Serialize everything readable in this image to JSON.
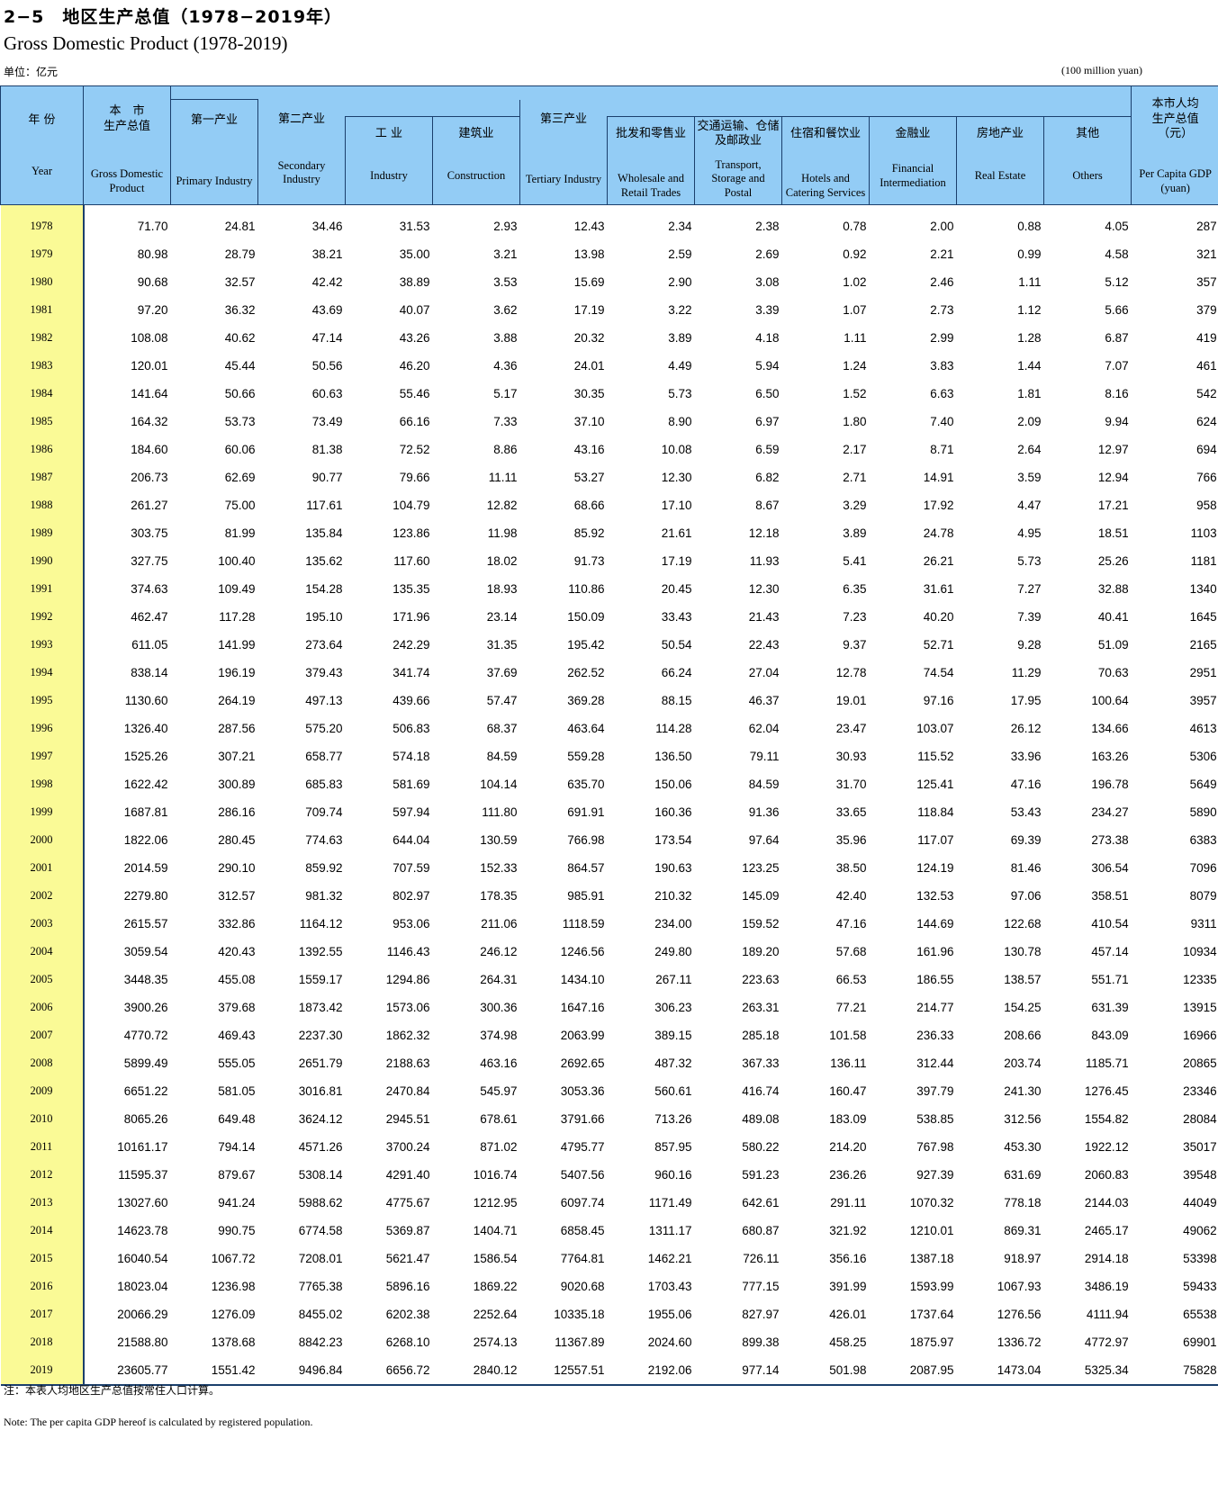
{
  "title_cn": "2−5　地区生产总值（1978−2019年）",
  "title_en": "Gross Domestic Product (1978-2019)",
  "unit_cn": "单位：亿元",
  "unit_en": "(100 million yuan)",
  "headers": {
    "year": {
      "cn": "年 份",
      "en": "Year"
    },
    "gdp": {
      "cn": "本　市\n生产总值",
      "en": "Gross Domestic Product"
    },
    "primary": {
      "cn": "第一产业",
      "en": "Primary Industry"
    },
    "secondary": {
      "cn": "第二产业",
      "en": "Secondary Industry"
    },
    "industry": {
      "cn": "工 业",
      "en": "Industry"
    },
    "construction": {
      "cn": "建筑业",
      "en": "Construction"
    },
    "tertiary": {
      "cn": "第三产业",
      "en": "Tertiary Industry"
    },
    "wholesale": {
      "cn": "批发和零售业",
      "en": "Wholesale and Retail Trades"
    },
    "transport": {
      "cn": "交通运输、仓储及邮政业",
      "en": "Transport, Storage and Postal"
    },
    "hotels": {
      "cn": "住宿和餐饮业",
      "en": "Hotels and Catering Services"
    },
    "finance": {
      "cn": "金融业",
      "en": "Financial Intermediation"
    },
    "realestate": {
      "cn": "房地产业",
      "en": "Real Estate"
    },
    "others": {
      "cn": "其他",
      "en": "Others"
    },
    "percapita": {
      "cn": "本市人均\n生产总值\n（元）",
      "en": "Per Capita GDP (yuan)"
    }
  },
  "rows": [
    [
      "1978",
      "71.70",
      "24.81",
      "34.46",
      "31.53",
      "2.93",
      "12.43",
      "2.34",
      "2.38",
      "0.78",
      "2.00",
      "0.88",
      "4.05",
      "287"
    ],
    [
      "1979",
      "80.98",
      "28.79",
      "38.21",
      "35.00",
      "3.21",
      "13.98",
      "2.59",
      "2.69",
      "0.92",
      "2.21",
      "0.99",
      "4.58",
      "321"
    ],
    [
      "1980",
      "90.68",
      "32.57",
      "42.42",
      "38.89",
      "3.53",
      "15.69",
      "2.90",
      "3.08",
      "1.02",
      "2.46",
      "1.11",
      "5.12",
      "357"
    ],
    [
      "1981",
      "97.20",
      "36.32",
      "43.69",
      "40.07",
      "3.62",
      "17.19",
      "3.22",
      "3.39",
      "1.07",
      "2.73",
      "1.12",
      "5.66",
      "379"
    ],
    [
      "1982",
      "108.08",
      "40.62",
      "47.14",
      "43.26",
      "3.88",
      "20.32",
      "3.89",
      "4.18",
      "1.11",
      "2.99",
      "1.28",
      "6.87",
      "419"
    ],
    [
      "1983",
      "120.01",
      "45.44",
      "50.56",
      "46.20",
      "4.36",
      "24.01",
      "4.49",
      "5.94",
      "1.24",
      "3.83",
      "1.44",
      "7.07",
      "461"
    ],
    [
      "1984",
      "141.64",
      "50.66",
      "60.63",
      "55.46",
      "5.17",
      "30.35",
      "5.73",
      "6.50",
      "1.52",
      "6.63",
      "1.81",
      "8.16",
      "542"
    ],
    [
      "1985",
      "164.32",
      "53.73",
      "73.49",
      "66.16",
      "7.33",
      "37.10",
      "8.90",
      "6.97",
      "1.80",
      "7.40",
      "2.09",
      "9.94",
      "624"
    ],
    [
      "1986",
      "184.60",
      "60.06",
      "81.38",
      "72.52",
      "8.86",
      "43.16",
      "10.08",
      "6.59",
      "2.17",
      "8.71",
      "2.64",
      "12.97",
      "694"
    ],
    [
      "1987",
      "206.73",
      "62.69",
      "90.77",
      "79.66",
      "11.11",
      "53.27",
      "12.30",
      "6.82",
      "2.71",
      "14.91",
      "3.59",
      "12.94",
      "766"
    ],
    [
      "1988",
      "261.27",
      "75.00",
      "117.61",
      "104.79",
      "12.82",
      "68.66",
      "17.10",
      "8.67",
      "3.29",
      "17.92",
      "4.47",
      "17.21",
      "958"
    ],
    [
      "1989",
      "303.75",
      "81.99",
      "135.84",
      "123.86",
      "11.98",
      "85.92",
      "21.61",
      "12.18",
      "3.89",
      "24.78",
      "4.95",
      "18.51",
      "1103"
    ],
    [
      "1990",
      "327.75",
      "100.40",
      "135.62",
      "117.60",
      "18.02",
      "91.73",
      "17.19",
      "11.93",
      "5.41",
      "26.21",
      "5.73",
      "25.26",
      "1181"
    ],
    [
      "1991",
      "374.63",
      "109.49",
      "154.28",
      "135.35",
      "18.93",
      "110.86",
      "20.45",
      "12.30",
      "6.35",
      "31.61",
      "7.27",
      "32.88",
      "1340"
    ],
    [
      "1992",
      "462.47",
      "117.28",
      "195.10",
      "171.96",
      "23.14",
      "150.09",
      "33.43",
      "21.43",
      "7.23",
      "40.20",
      "7.39",
      "40.41",
      "1645"
    ],
    [
      "1993",
      "611.05",
      "141.99",
      "273.64",
      "242.29",
      "31.35",
      "195.42",
      "50.54",
      "22.43",
      "9.37",
      "52.71",
      "9.28",
      "51.09",
      "2165"
    ],
    [
      "1994",
      "838.14",
      "196.19",
      "379.43",
      "341.74",
      "37.69",
      "262.52",
      "66.24",
      "27.04",
      "12.78",
      "74.54",
      "11.29",
      "70.63",
      "2951"
    ],
    [
      "1995",
      "1130.60",
      "264.19",
      "497.13",
      "439.66",
      "57.47",
      "369.28",
      "88.15",
      "46.37",
      "19.01",
      "97.16",
      "17.95",
      "100.64",
      "3957"
    ],
    [
      "1996",
      "1326.40",
      "287.56",
      "575.20",
      "506.83",
      "68.37",
      "463.64",
      "114.28",
      "62.04",
      "23.47",
      "103.07",
      "26.12",
      "134.66",
      "4613"
    ],
    [
      "1997",
      "1525.26",
      "307.21",
      "658.77",
      "574.18",
      "84.59",
      "559.28",
      "136.50",
      "79.11",
      "30.93",
      "115.52",
      "33.96",
      "163.26",
      "5306"
    ],
    [
      "1998",
      "1622.42",
      "300.89",
      "685.83",
      "581.69",
      "104.14",
      "635.70",
      "150.06",
      "84.59",
      "31.70",
      "125.41",
      "47.16",
      "196.78",
      "5649"
    ],
    [
      "1999",
      "1687.81",
      "286.16",
      "709.74",
      "597.94",
      "111.80",
      "691.91",
      "160.36",
      "91.36",
      "33.65",
      "118.84",
      "53.43",
      "234.27",
      "5890"
    ],
    [
      "2000",
      "1822.06",
      "280.45",
      "774.63",
      "644.04",
      "130.59",
      "766.98",
      "173.54",
      "97.64",
      "35.96",
      "117.07",
      "69.39",
      "273.38",
      "6383"
    ],
    [
      "2001",
      "2014.59",
      "290.10",
      "859.92",
      "707.59",
      "152.33",
      "864.57",
      "190.63",
      "123.25",
      "38.50",
      "124.19",
      "81.46",
      "306.54",
      "7096"
    ],
    [
      "2002",
      "2279.80",
      "312.57",
      "981.32",
      "802.97",
      "178.35",
      "985.91",
      "210.32",
      "145.09",
      "42.40",
      "132.53",
      "97.06",
      "358.51",
      "8079"
    ],
    [
      "2003",
      "2615.57",
      "332.86",
      "1164.12",
      "953.06",
      "211.06",
      "1118.59",
      "234.00",
      "159.52",
      "47.16",
      "144.69",
      "122.68",
      "410.54",
      "9311"
    ],
    [
      "2004",
      "3059.54",
      "420.43",
      "1392.55",
      "1146.43",
      "246.12",
      "1246.56",
      "249.80",
      "189.20",
      "57.68",
      "161.96",
      "130.78",
      "457.14",
      "10934"
    ],
    [
      "2005",
      "3448.35",
      "455.08",
      "1559.17",
      "1294.86",
      "264.31",
      "1434.10",
      "267.11",
      "223.63",
      "66.53",
      "186.55",
      "138.57",
      "551.71",
      "12335"
    ],
    [
      "2006",
      "3900.26",
      "379.68",
      "1873.42",
      "1573.06",
      "300.36",
      "1647.16",
      "306.23",
      "263.31",
      "77.21",
      "214.77",
      "154.25",
      "631.39",
      "13915"
    ],
    [
      "2007",
      "4770.72",
      "469.43",
      "2237.30",
      "1862.32",
      "374.98",
      "2063.99",
      "389.15",
      "285.18",
      "101.58",
      "236.33",
      "208.66",
      "843.09",
      "16966"
    ],
    [
      "2008",
      "5899.49",
      "555.05",
      "2651.79",
      "2188.63",
      "463.16",
      "2692.65",
      "487.32",
      "367.33",
      "136.11",
      "312.44",
      "203.74",
      "1185.71",
      "20865"
    ],
    [
      "2009",
      "6651.22",
      "581.05",
      "3016.81",
      "2470.84",
      "545.97",
      "3053.36",
      "560.61",
      "416.74",
      "160.47",
      "397.79",
      "241.30",
      "1276.45",
      "23346"
    ],
    [
      "2010",
      "8065.26",
      "649.48",
      "3624.12",
      "2945.51",
      "678.61",
      "3791.66",
      "713.26",
      "489.08",
      "183.09",
      "538.85",
      "312.56",
      "1554.82",
      "28084"
    ],
    [
      "2011",
      "10161.17",
      "794.14",
      "4571.26",
      "3700.24",
      "871.02",
      "4795.77",
      "857.95",
      "580.22",
      "214.20",
      "767.98",
      "453.30",
      "1922.12",
      "35017"
    ],
    [
      "2012",
      "11595.37",
      "879.67",
      "5308.14",
      "4291.40",
      "1016.74",
      "5407.56",
      "960.16",
      "591.23",
      "236.26",
      "927.39",
      "631.69",
      "2060.83",
      "39548"
    ],
    [
      "2013",
      "13027.60",
      "941.24",
      "5988.62",
      "4775.67",
      "1212.95",
      "6097.74",
      "1171.49",
      "642.61",
      "291.11",
      "1070.32",
      "778.18",
      "2144.03",
      "44049"
    ],
    [
      "2014",
      "14623.78",
      "990.75",
      "6774.58",
      "5369.87",
      "1404.71",
      "6858.45",
      "1311.17",
      "680.87",
      "321.92",
      "1210.01",
      "869.31",
      "2465.17",
      "49062"
    ],
    [
      "2015",
      "16040.54",
      "1067.72",
      "7208.01",
      "5621.47",
      "1586.54",
      "7764.81",
      "1462.21",
      "726.11",
      "356.16",
      "1387.18",
      "918.97",
      "2914.18",
      "53398"
    ],
    [
      "2016",
      "18023.04",
      "1236.98",
      "7765.38",
      "5896.16",
      "1869.22",
      "9020.68",
      "1703.43",
      "777.15",
      "391.99",
      "1593.99",
      "1067.93",
      "3486.19",
      "59433"
    ],
    [
      "2017",
      "20066.29",
      "1276.09",
      "8455.02",
      "6202.38",
      "2252.64",
      "10335.18",
      "1955.06",
      "827.97",
      "426.01",
      "1737.64",
      "1276.56",
      "4111.94",
      "65538"
    ],
    [
      "2018",
      "21588.80",
      "1378.68",
      "8842.23",
      "6268.10",
      "2574.13",
      "11367.89",
      "2024.60",
      "899.38",
      "458.25",
      "1875.97",
      "1336.72",
      "4772.97",
      "69901"
    ],
    [
      "2019",
      "23605.77",
      "1551.42",
      "9496.84",
      "6656.72",
      "2840.12",
      "12557.51",
      "2192.06",
      "977.14",
      "501.98",
      "2087.95",
      "1473.04",
      "5325.34",
      "75828"
    ]
  ],
  "note_cn": "注：本表人均地区生产总值按常住人口计算。",
  "note_en": "Note: The per capita GDP hereof is calculated by registered population.",
  "colors": {
    "header_bg": "#93ccf5",
    "year_bg": "#fafa96",
    "rule": "#1b3f6c"
  }
}
